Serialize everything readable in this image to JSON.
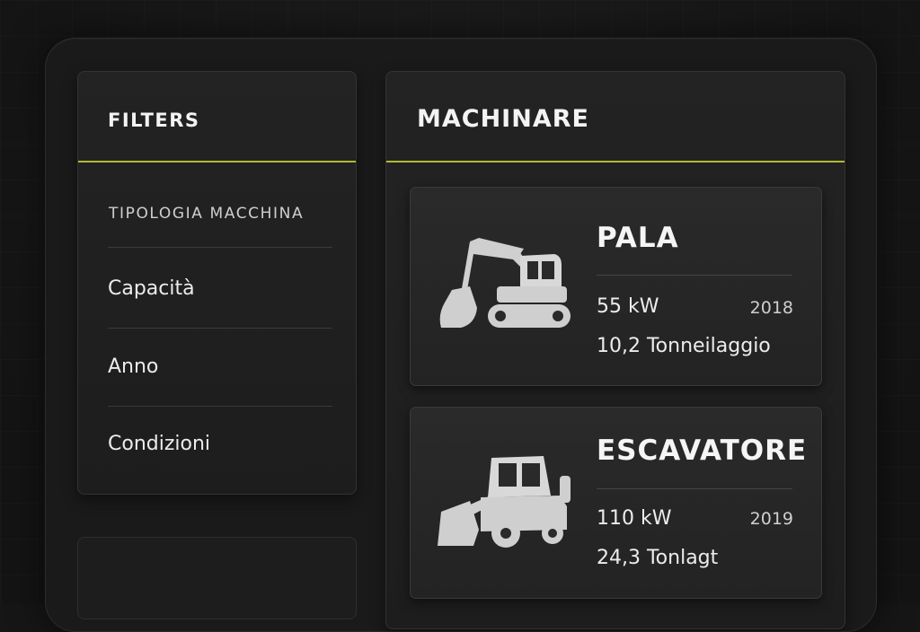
{
  "filters": {
    "title": "FILTERS",
    "heading": "TIPOLOGIA MACCHINA",
    "items": [
      "Capacità",
      "Anno",
      "Condizioni"
    ]
  },
  "machinery": {
    "title": "MACHINARE",
    "cards": [
      {
        "name": "PALA",
        "power": "55 kW",
        "year": "2018",
        "weight": "10,2 Tonneilaggio",
        "icon": "excavator-icon"
      },
      {
        "name": "ESCAVATORE",
        "power": "110 kW",
        "year": "2019",
        "weight": "24,3 Tonlagt",
        "icon": "loader-icon"
      }
    ]
  },
  "colors": {
    "accent": "#c9d63a",
    "background": "#161616",
    "panel": "#232323"
  }
}
